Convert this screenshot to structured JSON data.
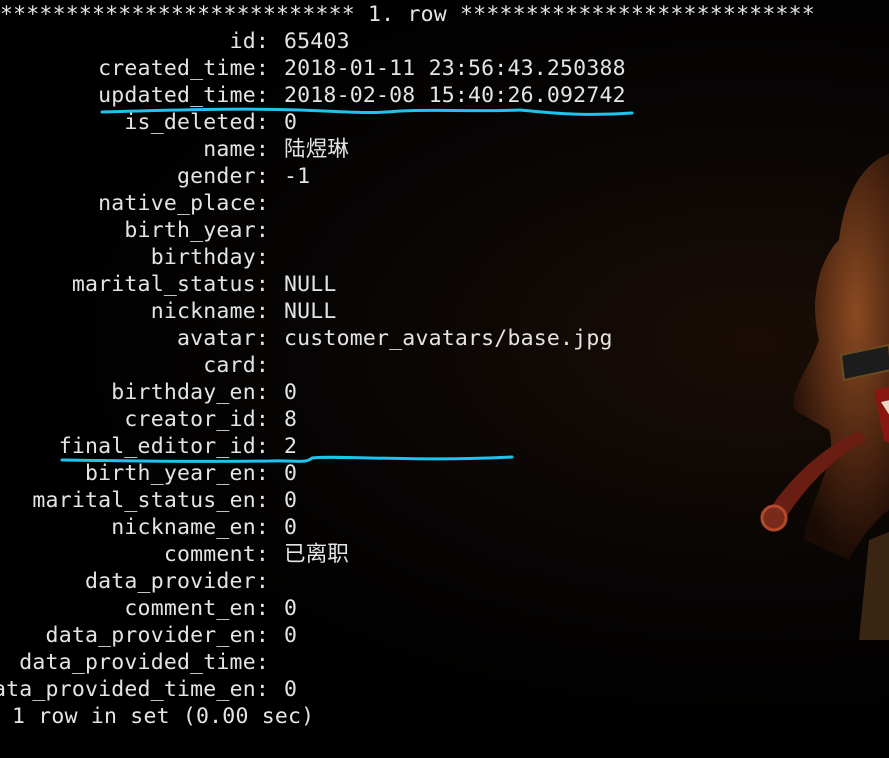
{
  "header": "*************************** 1. row ***************************",
  "rows": [
    {
      "key": "id",
      "value": "65403"
    },
    {
      "key": "created_time",
      "value": "2018-01-11 23:56:43.250388"
    },
    {
      "key": "updated_time",
      "value": "2018-02-08 15:40:26.092742"
    },
    {
      "key": "is_deleted",
      "value": "0"
    },
    {
      "key": "name",
      "value": "陆煜琳"
    },
    {
      "key": "gender",
      "value": "-1"
    },
    {
      "key": "native_place",
      "value": ""
    },
    {
      "key": "birth_year",
      "value": ""
    },
    {
      "key": "birthday",
      "value": ""
    },
    {
      "key": "marital_status",
      "value": "NULL"
    },
    {
      "key": "nickname",
      "value": "NULL"
    },
    {
      "key": "avatar",
      "value": "customer_avatars/base.jpg"
    },
    {
      "key": "card",
      "value": ""
    },
    {
      "key": "birthday_en",
      "value": "0"
    },
    {
      "key": "creator_id",
      "value": "8"
    },
    {
      "key": "final_editor_id",
      "value": "2"
    },
    {
      "key": "birth_year_en",
      "value": "0"
    },
    {
      "key": "marital_status_en",
      "value": "0"
    },
    {
      "key": "nickname_en",
      "value": "0"
    },
    {
      "key": "comment",
      "value": "已离职"
    },
    {
      "key": "data_provider",
      "value": ""
    },
    {
      "key": "comment_en",
      "value": "0"
    },
    {
      "key": "data_provider_en",
      "value": "0"
    },
    {
      "key": "data_provided_time",
      "value": ""
    },
    {
      "key": "data_provided_time_en",
      "value": "0"
    }
  ],
  "footer": "1 row in set (0.00 sec)",
  "colors": {
    "background": "#000000",
    "text": "#e4e4e4",
    "annotation_underline": "#1fc4ee"
  }
}
